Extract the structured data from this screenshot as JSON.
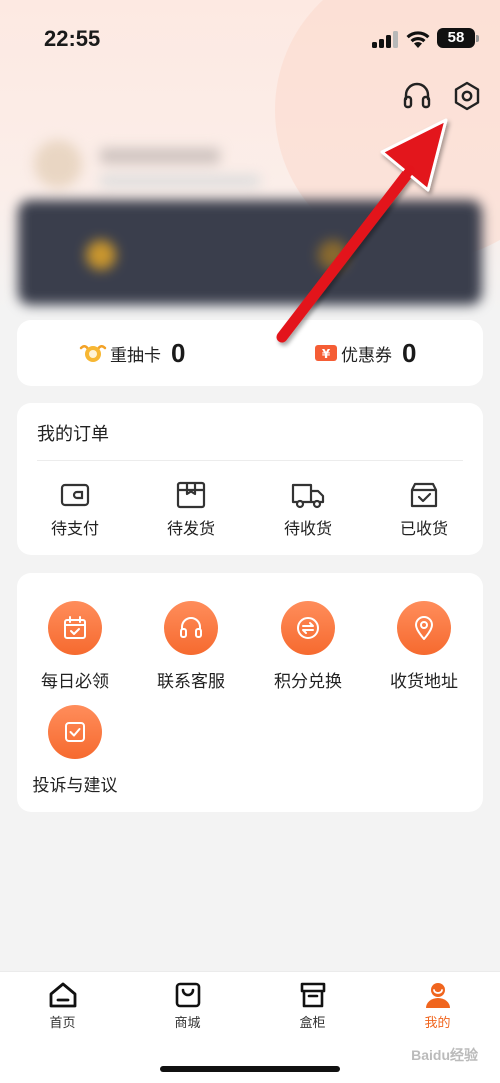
{
  "status_bar": {
    "time": "22:55",
    "battery": "58"
  },
  "header": {
    "support_icon": "headset-icon",
    "settings_icon": "settings-hex-icon"
  },
  "stats": [
    {
      "label": "重抽卡",
      "value": "0",
      "icon": "redraw-card-icon"
    },
    {
      "label": "优惠券",
      "value": "0",
      "icon": "coupon-icon"
    }
  ],
  "orders": {
    "title": "我的订单",
    "items": [
      {
        "label": "待支付",
        "icon": "wallet-icon"
      },
      {
        "label": "待发货",
        "icon": "package-icon"
      },
      {
        "label": "待收货",
        "icon": "truck-icon"
      },
      {
        "label": "已收货",
        "icon": "received-box-icon"
      }
    ]
  },
  "services": [
    {
      "label": "每日必领",
      "icon": "calendar-check-icon"
    },
    {
      "label": "联系客服",
      "icon": "headset-icon"
    },
    {
      "label": "积分兑换",
      "icon": "exchange-icon"
    },
    {
      "label": "收货地址",
      "icon": "location-pin-icon"
    },
    {
      "label": "投诉与建议",
      "icon": "feedback-icon"
    }
  ],
  "tabbar": [
    {
      "label": "首页",
      "icon": "home-icon",
      "active": false
    },
    {
      "label": "商城",
      "icon": "shopping-bag-icon",
      "active": false
    },
    {
      "label": "盒柜",
      "icon": "cabinet-icon",
      "active": false
    },
    {
      "label": "我的",
      "icon": "user-icon",
      "active": true
    }
  ],
  "watermark": "Baidu经验",
  "colors": {
    "accent": "#f0651e",
    "annotation_arrow": "#e3141b"
  }
}
